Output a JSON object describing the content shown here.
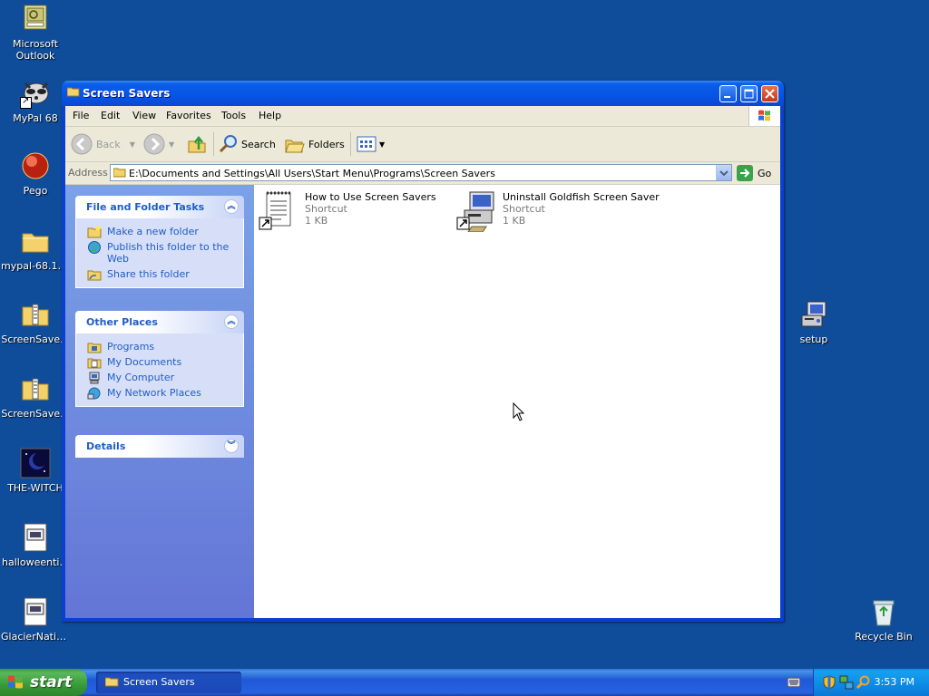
{
  "desktop": {
    "icons": [
      {
        "label": "Microsoft Outlook"
      },
      {
        "label": "MyPal 68"
      },
      {
        "label": "Pego"
      },
      {
        "label": "mypal-68.13..."
      },
      {
        "label": "ScreenSave..."
      },
      {
        "label": "ScreenSave..."
      },
      {
        "label": "THE-WITCH"
      },
      {
        "label": "halloweenti..."
      },
      {
        "label": "GlacierNatio..."
      },
      {
        "label": "setup"
      },
      {
        "label": "Recycle Bin"
      }
    ]
  },
  "window": {
    "title": "Screen Savers",
    "menu": [
      "File",
      "Edit",
      "View",
      "Favorites",
      "Tools",
      "Help"
    ],
    "toolbar": {
      "back": "Back",
      "search": "Search",
      "folders": "Folders"
    },
    "address": {
      "label": "Address",
      "value": "E:\\Documents and Settings\\All Users\\Start Menu\\Programs\\Screen Savers",
      "go": "Go"
    },
    "panels": {
      "file_tasks": {
        "title": "File and Folder Tasks",
        "items": [
          "Make a new folder",
          "Publish this folder to the Web",
          "Share this folder"
        ]
      },
      "other_places": {
        "title": "Other Places",
        "items": [
          "Programs",
          "My Documents",
          "My Computer",
          "My Network Places"
        ]
      },
      "details": {
        "title": "Details"
      }
    },
    "files": [
      {
        "name": "How to Use Screen Savers",
        "type": "Shortcut",
        "size": "1 KB",
        "icon": "notepad-shortcut-icon"
      },
      {
        "name": "Uninstall Goldfish Screen Saver",
        "type": "Shortcut",
        "size": "1 KB",
        "icon": "setup-shortcut-icon"
      }
    ]
  },
  "taskbar": {
    "start": "start",
    "tasks": [
      {
        "label": "Screen Savers"
      }
    ],
    "clock": "3:53 PM"
  },
  "colors": {
    "desktop": "#0f4c9a",
    "titlebar": "#0654e6",
    "task_link": "#215dc6",
    "start_button": "#379a37"
  }
}
